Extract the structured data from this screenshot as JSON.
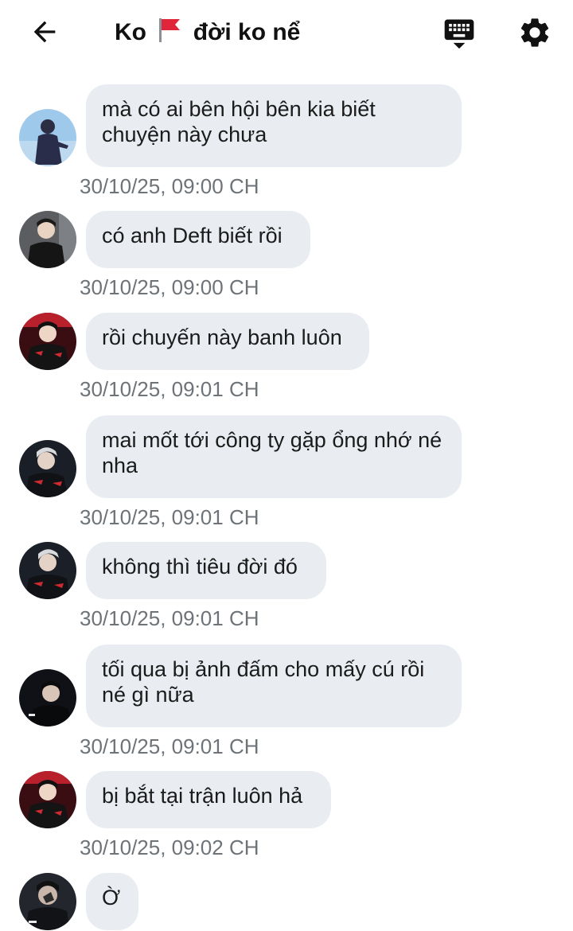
{
  "header": {
    "title_before_flag": "Ko",
    "title_after_flag": "đời ko nể",
    "back_icon": "arrow-left-icon",
    "keyboard_icon": "keyboard-icon",
    "settings_icon": "gear-icon"
  },
  "messages": [
    {
      "text": "mà có ai bên hội bên kia biết chuyện này chưa",
      "time": "30/10/25, 09:00 CH"
    },
    {
      "text": "có anh Deft biết rồi",
      "time": "30/10/25, 09:00 CH"
    },
    {
      "text": "rồi chuyến này banh luôn",
      "time": "30/10/25, 09:01 CH"
    },
    {
      "text": "mai mốt tới công ty gặp ổng nhớ né nha",
      "time": "30/10/25, 09:01 CH"
    },
    {
      "text": "không thì tiêu đời đó",
      "time": "30/10/25, 09:01 CH"
    },
    {
      "text": "tối qua bị ảnh đấm cho mấy cú rồi né gì nữa",
      "time": "30/10/25, 09:01 CH"
    },
    {
      "text": "bị bắt tại trận luôn hả",
      "time": "30/10/25, 09:02 CH"
    },
    {
      "text": "Ờ",
      "time": ""
    }
  ],
  "colors": {
    "bubble": "#e9edf2",
    "timestamp": "#6e7378",
    "text": "#1b1b1b"
  }
}
